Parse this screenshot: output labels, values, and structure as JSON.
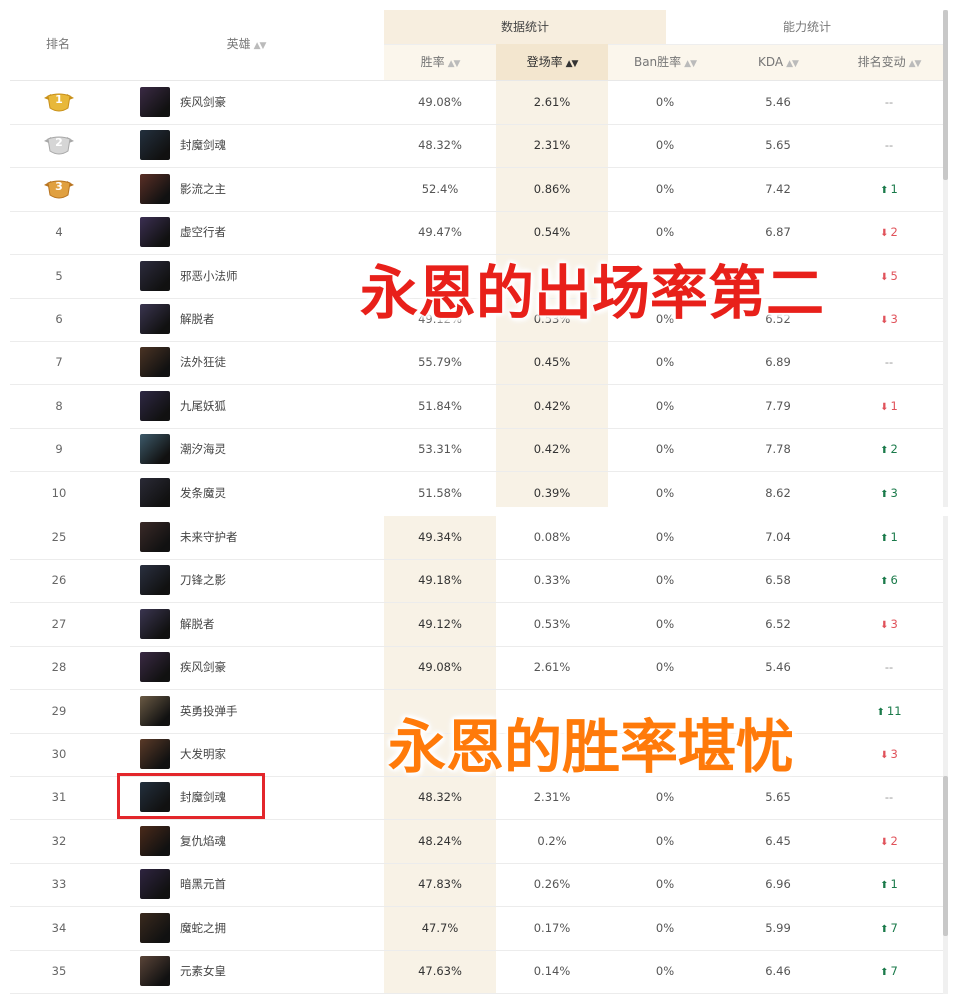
{
  "header": {
    "rank": "排名",
    "hero": "英雄",
    "group_data": "数据统计",
    "group_ability": "能力统计",
    "cols": {
      "win": "胜率",
      "pick": "登场率",
      "ban": "Ban胜率",
      "kda": "KDA",
      "change": "排名变动"
    }
  },
  "colors": {
    "highlight": "#f8f2e6",
    "header_highlight": "#f3e6cf",
    "up": "#1a7a4a",
    "down": "#e0525a",
    "overlay1": "#e8201a",
    "overlay2": "#ff7a0a",
    "redbox": "#e3262b"
  },
  "table_top": [
    {
      "rank": "1",
      "medal": "gold",
      "avatar": "#3a2a44",
      "hero": "疾风剑豪",
      "win": "49.08%",
      "pick": "2.61%",
      "ban": "0%",
      "kda": "5.46",
      "dir": "none",
      "change": "--"
    },
    {
      "rank": "2",
      "medal": "silver",
      "avatar": "#23303e",
      "hero": "封魔剑魂",
      "win": "48.32%",
      "pick": "2.31%",
      "ban": "0%",
      "kda": "5.65",
      "dir": "none",
      "change": "--"
    },
    {
      "rank": "3",
      "medal": "bronze",
      "avatar": "#5a2f26",
      "hero": "影流之主",
      "win": "52.4%",
      "pick": "0.86%",
      "ban": "0%",
      "kda": "7.42",
      "dir": "up",
      "change": "1"
    },
    {
      "rank": "4",
      "medal": "",
      "avatar": "#3b2f52",
      "hero": "虚空行者",
      "win": "49.47%",
      "pick": "0.54%",
      "ban": "0%",
      "kda": "6.87",
      "dir": "down",
      "change": "2"
    },
    {
      "rank": "5",
      "medal": "",
      "avatar": "#2c2b3d",
      "hero": "邪恶小法师",
      "win": "",
      "pick": "",
      "ban": "",
      "kda": "",
      "dir": "down",
      "change": "5"
    },
    {
      "rank": "6",
      "medal": "",
      "avatar": "#3a3550",
      "hero": "解脱者",
      "win": "49.12%",
      "pick": "0.53%",
      "ban": "0%",
      "kda": "6.52",
      "dir": "down",
      "change": "3"
    },
    {
      "rank": "7",
      "medal": "",
      "avatar": "#4a3324",
      "hero": "法外狂徒",
      "win": "55.79%",
      "pick": "0.45%",
      "ban": "0%",
      "kda": "6.89",
      "dir": "none",
      "change": "--"
    },
    {
      "rank": "8",
      "medal": "",
      "avatar": "#2e2844",
      "hero": "九尾妖狐",
      "win": "51.84%",
      "pick": "0.42%",
      "ban": "0%",
      "kda": "7.79",
      "dir": "down",
      "change": "1"
    },
    {
      "rank": "9",
      "medal": "",
      "avatar": "#3d5a6a",
      "hero": "潮汐海灵",
      "win": "53.31%",
      "pick": "0.42%",
      "ban": "0%",
      "kda": "7.78",
      "dir": "up",
      "change": "2"
    },
    {
      "rank": "10",
      "medal": "",
      "avatar": "#2a2a36",
      "hero": "发条魔灵",
      "win": "51.58%",
      "pick": "0.39%",
      "ban": "0%",
      "kda": "8.62",
      "dir": "up",
      "change": "3"
    }
  ],
  "table_bottom": [
    {
      "rank": "25",
      "avatar": "#3a2a28",
      "hero": "未来守护者",
      "win": "49.34%",
      "pick": "0.08%",
      "ban": "0%",
      "kda": "7.04",
      "dir": "up",
      "change": "1"
    },
    {
      "rank": "26",
      "avatar": "#2a3040",
      "hero": "刀锋之影",
      "win": "49.18%",
      "pick": "0.33%",
      "ban": "0%",
      "kda": "6.58",
      "dir": "up",
      "change": "6"
    },
    {
      "rank": "27",
      "avatar": "#3a3550",
      "hero": "解脱者",
      "win": "49.12%",
      "pick": "0.53%",
      "ban": "0%",
      "kda": "6.52",
      "dir": "down",
      "change": "3"
    },
    {
      "rank": "28",
      "avatar": "#3a2a44",
      "hero": "疾风剑豪",
      "win": "49.08%",
      "pick": "2.61%",
      "ban": "0%",
      "kda": "5.46",
      "dir": "none",
      "change": "--"
    },
    {
      "rank": "29",
      "avatar": "#6a5a44",
      "hero": "英勇投弹手",
      "win": "",
      "pick": "",
      "ban": "",
      "kda": "",
      "dir": "up",
      "change": "11"
    },
    {
      "rank": "30",
      "avatar": "#5a3a28",
      "hero": "大发明家",
      "win": "",
      "pick": "",
      "ban": "",
      "kda": "",
      "dir": "down",
      "change": "3"
    },
    {
      "rank": "31",
      "avatar": "#23303e",
      "hero": "封魔剑魂",
      "win": "48.32%",
      "pick": "2.31%",
      "ban": "0%",
      "kda": "5.65",
      "dir": "none",
      "change": "--"
    },
    {
      "rank": "32",
      "avatar": "#4a2a1a",
      "hero": "复仇焰魂",
      "win": "48.24%",
      "pick": "0.2%",
      "ban": "0%",
      "kda": "6.45",
      "dir": "down",
      "change": "2"
    },
    {
      "rank": "33",
      "avatar": "#2e2440",
      "hero": "暗黑元首",
      "win": "47.83%",
      "pick": "0.26%",
      "ban": "0%",
      "kda": "6.96",
      "dir": "up",
      "change": "1"
    },
    {
      "rank": "34",
      "avatar": "#3a2a1e",
      "hero": "魔蛇之拥",
      "win": "47.7%",
      "pick": "0.17%",
      "ban": "0%",
      "kda": "5.99",
      "dir": "up",
      "change": "7"
    },
    {
      "rank": "35",
      "avatar": "#5a4438",
      "hero": "元素女皇",
      "win": "47.63%",
      "pick": "0.14%",
      "ban": "0%",
      "kda": "6.46",
      "dir": "up",
      "change": "7"
    }
  ],
  "overlay": {
    "caption_pick": "永恩的出场率第二",
    "caption_win": "永恩的胜率堪忧"
  }
}
